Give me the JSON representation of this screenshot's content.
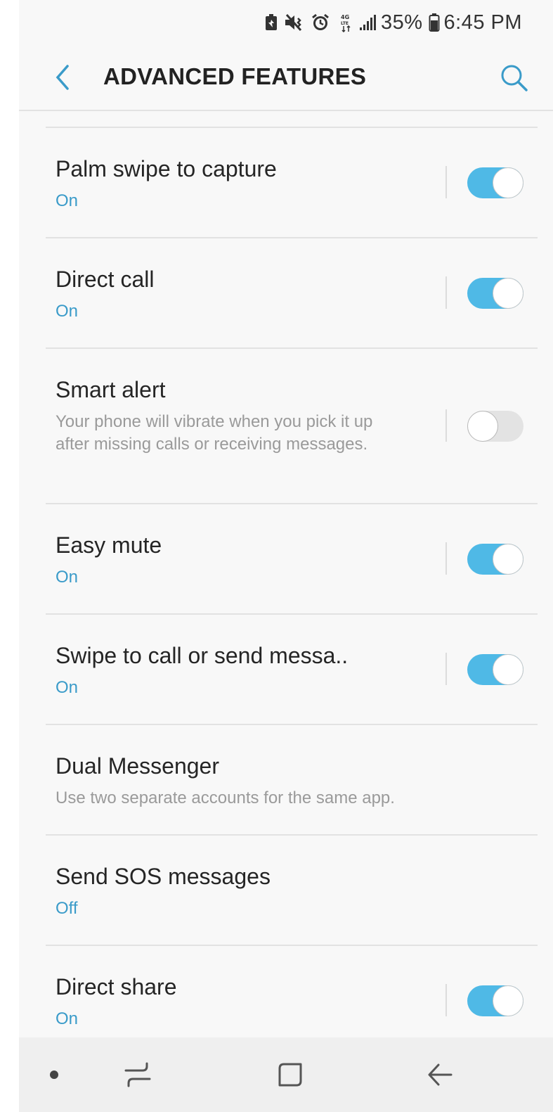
{
  "status_bar": {
    "battery": "35%",
    "time": "6:45 PM"
  },
  "header": {
    "title": "ADVANCED FEATURES"
  },
  "items": [
    {
      "title": "Palm swipe to capture",
      "sub": "On",
      "toggle": true
    },
    {
      "title": "Direct call",
      "sub": "On",
      "toggle": true
    },
    {
      "title": "Smart alert",
      "desc": "Your phone will vibrate when you pick it up after missing calls or receiving messages.",
      "toggle": false
    },
    {
      "title": "Easy mute",
      "sub": "On",
      "toggle": true
    },
    {
      "title": "Swipe to call or send messa..",
      "sub": "On",
      "toggle": true
    },
    {
      "title": "Dual Messenger",
      "desc": "Use two separate accounts for the same app."
    },
    {
      "title": "Send SOS messages",
      "sub": "Off"
    },
    {
      "title": "Direct share",
      "sub": "On",
      "toggle": true
    }
  ],
  "colors": {
    "accent": "#4fb9e6",
    "subtext": "#3a9bc9"
  }
}
